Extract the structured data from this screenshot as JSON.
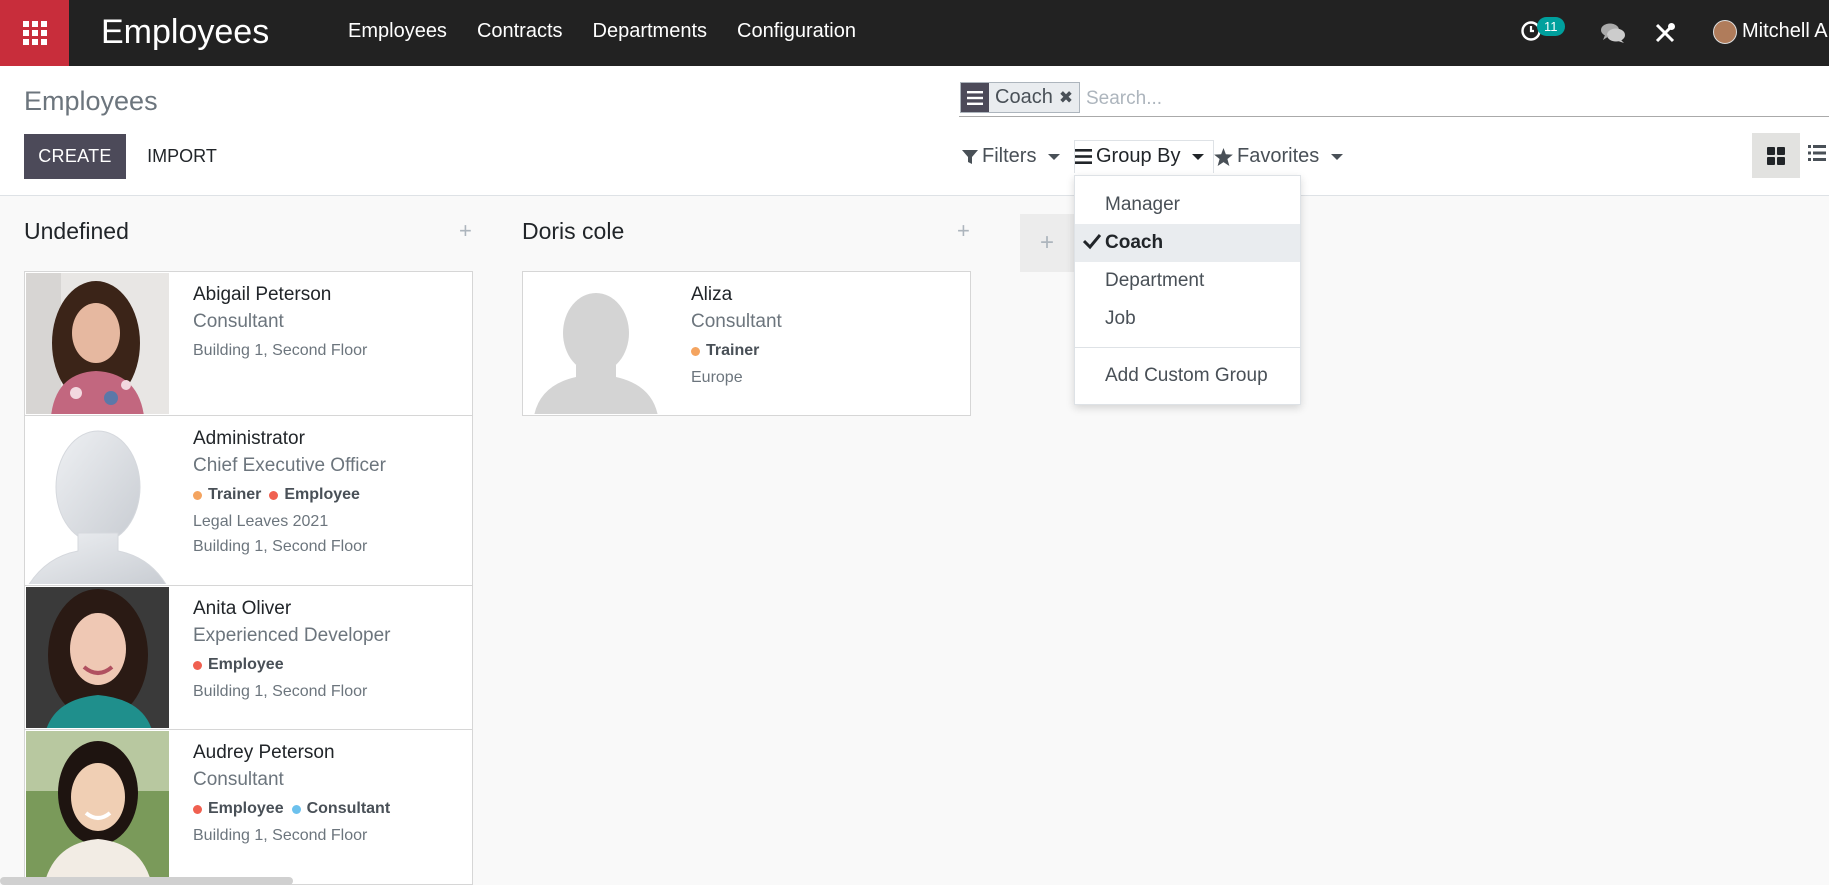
{
  "navbar": {
    "app_title": "Employees",
    "menu": [
      "Employees",
      "Contracts",
      "Departments",
      "Configuration"
    ],
    "activity_count": "11",
    "user_name": "Mitchell A"
  },
  "control_panel": {
    "breadcrumb": "Employees",
    "create_label": "CREATE",
    "import_label": "IMPORT",
    "search": {
      "facet": "Coach",
      "placeholder": "Search..."
    },
    "filters_label": "Filters",
    "group_by_label": "Group By",
    "favorites_label": "Favorites"
  },
  "group_by_menu": {
    "items": [
      "Manager",
      "Coach",
      "Department",
      "Job"
    ],
    "selected": "Coach",
    "custom_label": "Add Custom Group"
  },
  "columns": [
    {
      "title": "Undefined",
      "cards": [
        {
          "name": "Abigail Peterson",
          "job": "Consultant",
          "tags": [],
          "extra": [
            "Building 1, Second Floor"
          ]
        },
        {
          "name": "Administrator",
          "job": "Chief Executive Officer",
          "tags": [
            "Trainer",
            "Employee"
          ],
          "extra": [
            "Legal Leaves 2021",
            "Building 1, Second Floor"
          ]
        },
        {
          "name": "Anita Oliver",
          "job": "Experienced Developer",
          "tags": [
            "Employee"
          ],
          "extra": [
            "Building 1, Second Floor"
          ]
        },
        {
          "name": "Audrey Peterson",
          "job": "Consultant",
          "tags": [
            "Employee",
            "Consultant"
          ],
          "extra": [
            "Building 1, Second Floor"
          ]
        }
      ]
    },
    {
      "title": "Doris cole",
      "cards": [
        {
          "name": "Aliza",
          "job": "Consultant",
          "tags": [
            "Trainer"
          ],
          "extra": [
            "Europe"
          ]
        }
      ]
    }
  ],
  "colors": {
    "navbar": "#222222",
    "apps_button": "#c82d3b",
    "primary": "#4c4a59",
    "tag_trainer": "#f4a460",
    "tag_employee": "#f06050",
    "tag_consultant": "#6cc1ed",
    "badge": "#00a09d"
  }
}
